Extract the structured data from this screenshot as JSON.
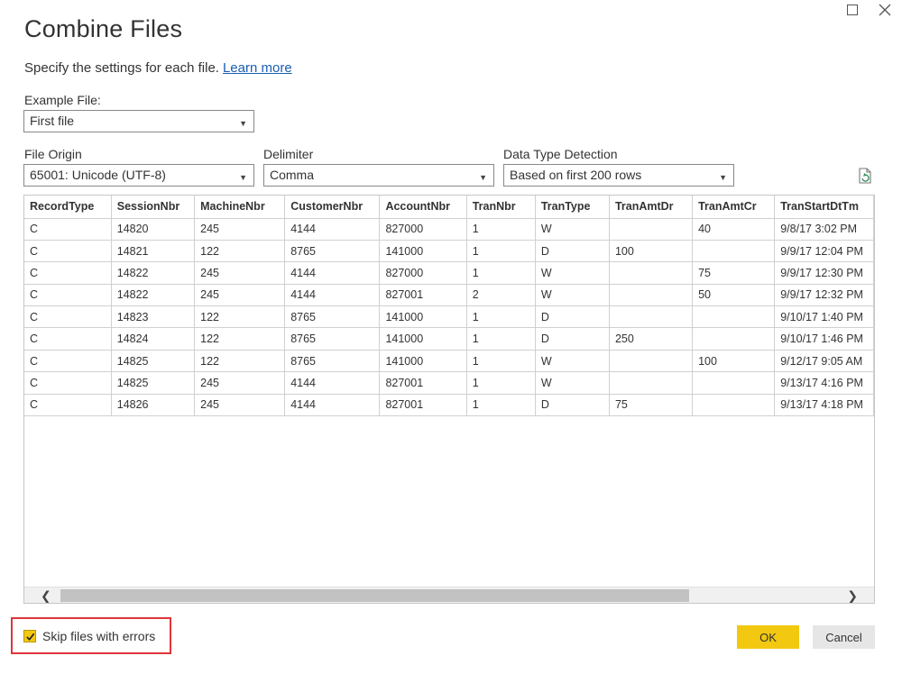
{
  "dialog": {
    "title": "Combine Files",
    "subtitle": "Specify the settings for each file.",
    "learn_more": "Learn more"
  },
  "example_file": {
    "label": "Example File:",
    "value": "First file"
  },
  "file_origin": {
    "label": "File Origin",
    "value": "65001: Unicode (UTF-8)"
  },
  "delimiter": {
    "label": "Delimiter",
    "value": "Comma"
  },
  "data_type_detection": {
    "label": "Data Type Detection",
    "value": "Based on first 200 rows"
  },
  "table": {
    "columns": [
      "RecordType",
      "SessionNbr",
      "MachineNbr",
      "CustomerNbr",
      "AccountNbr",
      "TranNbr",
      "TranType",
      "TranAmtDr",
      "TranAmtCr",
      "TranStartDtTm"
    ],
    "rows": [
      [
        "C",
        "14820",
        "245",
        "4144",
        "827000",
        "1",
        "W",
        "",
        "40",
        "9/8/17 3:02 PM"
      ],
      [
        "C",
        "14821",
        "122",
        "8765",
        "141000",
        "1",
        "D",
        "100",
        "",
        "9/9/17 12:04 PM"
      ],
      [
        "C",
        "14822",
        "245",
        "4144",
        "827000",
        "1",
        "W",
        "",
        "75",
        "9/9/17 12:30 PM"
      ],
      [
        "C",
        "14822",
        "245",
        "4144",
        "827001",
        "2",
        "W",
        "",
        "50",
        "9/9/17 12:32 PM"
      ],
      [
        "C",
        "14823",
        "122",
        "8765",
        "141000",
        "1",
        "D",
        "",
        "",
        "9/10/17 1:40 PM"
      ],
      [
        "C",
        "14824",
        "122",
        "8765",
        "141000",
        "1",
        "D",
        "250",
        "",
        "9/10/17 1:46 PM"
      ],
      [
        "C",
        "14825",
        "122",
        "8765",
        "141000",
        "1",
        "W",
        "",
        "100",
        "9/12/17 9:05 AM"
      ],
      [
        "C",
        "14825",
        "245",
        "4144",
        "827001",
        "1",
        "W",
        "",
        "",
        "9/13/17 4:16 PM"
      ],
      [
        "C",
        "14826",
        "245",
        "4144",
        "827001",
        "1",
        "D",
        "75",
        "",
        "9/13/17 4:18 PM"
      ]
    ]
  },
  "skip_files": {
    "label": "Skip files with errors",
    "checked": true
  },
  "buttons": {
    "ok": "OK",
    "cancel": "Cancel"
  },
  "colors": {
    "accent": "#f2c811",
    "highlight": "#e0353b",
    "link": "#1a5fb4"
  }
}
